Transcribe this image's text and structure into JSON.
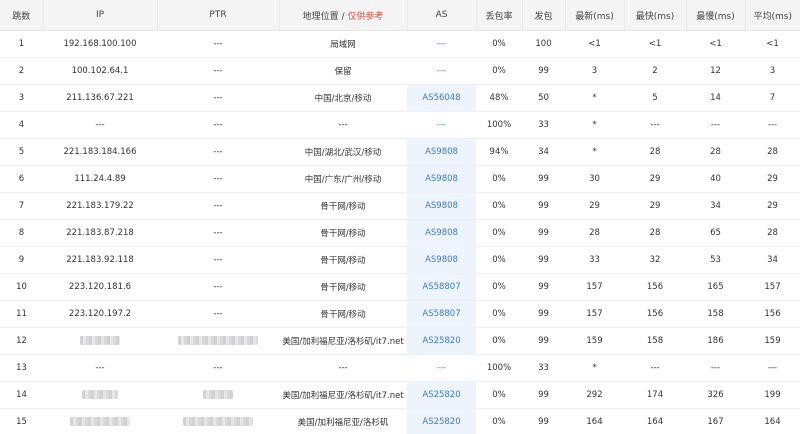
{
  "table": {
    "headers": {
      "hop": "跳数",
      "ip": "IP",
      "ptr": "PTR",
      "geo": "地理位置",
      "geo_sep": " / ",
      "geo_note": "仅供参考",
      "as": "AS",
      "loss": "丢包率",
      "sent": "发包",
      "last": "最新(ms)",
      "best": "最快(ms)",
      "worst": "最慢(ms)",
      "avg": "平均(ms)"
    },
    "rows": [
      {
        "hop": "1",
        "ip": "192.168.100.100",
        "ptr": "---",
        "geo": "局域网",
        "as": "---",
        "loss": "0%",
        "sent": "100",
        "last": "<1",
        "best": "<1",
        "worst": "<1",
        "avg": "<1"
      },
      {
        "hop": "2",
        "ip": "100.102.64.1",
        "ptr": "---",
        "geo": "保留",
        "as": "---",
        "loss": "0%",
        "sent": "99",
        "last": "3",
        "best": "2",
        "worst": "12",
        "avg": "3"
      },
      {
        "hop": "3",
        "ip": "211.136.67.221",
        "ptr": "---",
        "geo": "中国/北京/移动",
        "as": "AS56048",
        "loss": "48%",
        "sent": "50",
        "last": "*",
        "best": "5",
        "worst": "14",
        "avg": "7"
      },
      {
        "hop": "4",
        "ip": "---",
        "ptr": "---",
        "geo": "---",
        "as": "---",
        "loss": "100%",
        "sent": "33",
        "last": "*",
        "best": "---",
        "worst": "---",
        "avg": "---"
      },
      {
        "hop": "5",
        "ip": "221.183.184.166",
        "ptr": "---",
        "geo": "中国/湖北/武汉/移动",
        "as": "AS9808",
        "loss": "94%",
        "sent": "34",
        "last": "*",
        "best": "28",
        "worst": "28",
        "avg": "28"
      },
      {
        "hop": "6",
        "ip": "111.24.4.89",
        "ptr": "---",
        "geo": "中国/广东/广州/移动",
        "as": "AS9808",
        "loss": "0%",
        "sent": "99",
        "last": "30",
        "best": "29",
        "worst": "40",
        "avg": "29"
      },
      {
        "hop": "7",
        "ip": "221.183.179.22",
        "ptr": "---",
        "geo": "骨干网/移动",
        "as": "AS9808",
        "loss": "0%",
        "sent": "99",
        "last": "29",
        "best": "29",
        "worst": "34",
        "avg": "29"
      },
      {
        "hop": "8",
        "ip": "221.183.87.218",
        "ptr": "---",
        "geo": "骨干网/移动",
        "as": "AS9808",
        "loss": "0%",
        "sent": "99",
        "last": "28",
        "best": "28",
        "worst": "65",
        "avg": "28"
      },
      {
        "hop": "9",
        "ip": "221.183.92.118",
        "ptr": "---",
        "geo": "骨干网/移动",
        "as": "AS9808",
        "loss": "0%",
        "sent": "99",
        "last": "33",
        "best": "32",
        "worst": "53",
        "avg": "34"
      },
      {
        "hop": "10",
        "ip": "223.120.181.6",
        "ptr": "---",
        "geo": "骨干网/移动",
        "as": "AS58807",
        "loss": "0%",
        "sent": "99",
        "last": "157",
        "best": "156",
        "worst": "165",
        "avg": "157"
      },
      {
        "hop": "11",
        "ip": "223.120.197.2",
        "ptr": "---",
        "geo": "骨干网/移动",
        "as": "AS58807",
        "loss": "0%",
        "sent": "99",
        "last": "157",
        "best": "156",
        "worst": "158",
        "avg": "156"
      },
      {
        "hop": "12",
        "ip": "",
        "ptr": "",
        "geo": "美国/加利福尼亚/洛杉矶/it7.net",
        "as": "AS25820",
        "loss": "0%",
        "sent": "99",
        "last": "159",
        "best": "158",
        "worst": "186",
        "avg": "159"
      },
      {
        "hop": "13",
        "ip": "---",
        "ptr": "---",
        "geo": "---",
        "as": "---",
        "loss": "100%",
        "sent": "33",
        "last": "*",
        "best": "---",
        "worst": "---",
        "avg": "---"
      },
      {
        "hop": "14",
        "ip": "",
        "ptr": "",
        "geo": "美国/加利福尼亚/洛杉矶/it7.net",
        "as": "AS25820",
        "loss": "0%",
        "sent": "99",
        "last": "292",
        "best": "174",
        "worst": "326",
        "avg": "199"
      },
      {
        "hop": "15",
        "ip": "",
        "ptr": "",
        "geo": "美国/加利福尼亚/洛杉矶",
        "as": "AS25820",
        "loss": "0%",
        "sent": "99",
        "last": "164",
        "best": "164",
        "worst": "167",
        "avg": "164"
      }
    ]
  }
}
